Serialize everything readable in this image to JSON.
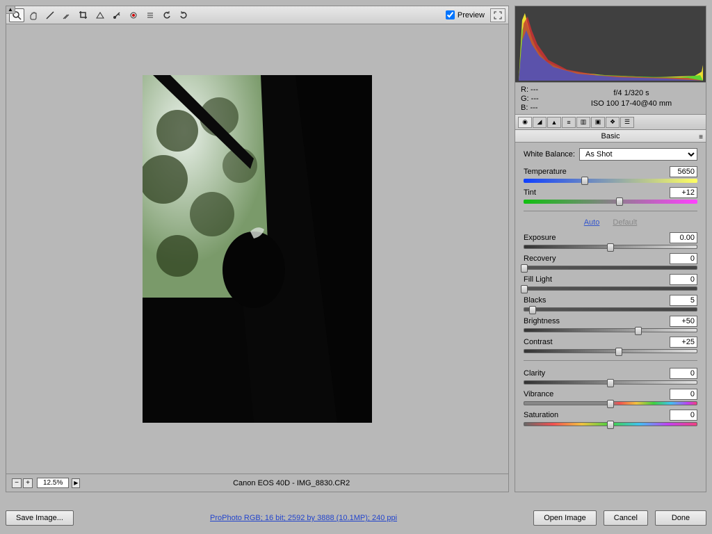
{
  "toolbar": {
    "preview_label": "Preview",
    "preview_checked": true
  },
  "zoom": {
    "level": "12.5%"
  },
  "status": {
    "camera_file": "Canon EOS 40D  -  IMG_8830.CR2"
  },
  "metadata": {
    "r": "R:   ---",
    "g": "G:   ---",
    "b": "B:   ---",
    "aperture_shutter": "f/4   1/320 s",
    "iso_lens": "ISO 100   17-40@40 mm"
  },
  "panel": {
    "title": "Basic",
    "wb_label": "White Balance:",
    "wb_value": "As Shot",
    "auto": "Auto",
    "default": "Default",
    "sliders": {
      "temperature": {
        "label": "Temperature",
        "value": "5650",
        "pos": 35
      },
      "tint": {
        "label": "Tint",
        "value": "+12",
        "pos": 55
      },
      "exposure": {
        "label": "Exposure",
        "value": "0.00",
        "pos": 50
      },
      "recovery": {
        "label": "Recovery",
        "value": "0",
        "pos": 0
      },
      "fill": {
        "label": "Fill Light",
        "value": "0",
        "pos": 0
      },
      "blacks": {
        "label": "Blacks",
        "value": "5",
        "pos": 5
      },
      "brightness": {
        "label": "Brightness",
        "value": "+50",
        "pos": 66
      },
      "contrast": {
        "label": "Contrast",
        "value": "+25",
        "pos": 55
      },
      "clarity": {
        "label": "Clarity",
        "value": "0",
        "pos": 50
      },
      "vibrance": {
        "label": "Vibrance",
        "value": "0",
        "pos": 50
      },
      "saturation": {
        "label": "Saturation",
        "value": "0",
        "pos": 50
      }
    }
  },
  "footer": {
    "save": "Save Image...",
    "info": "ProPhoto RGB; 16 bit; 2592 by 3888 (10.1MP); 240 ppi",
    "open": "Open Image",
    "cancel": "Cancel",
    "done": "Done"
  }
}
